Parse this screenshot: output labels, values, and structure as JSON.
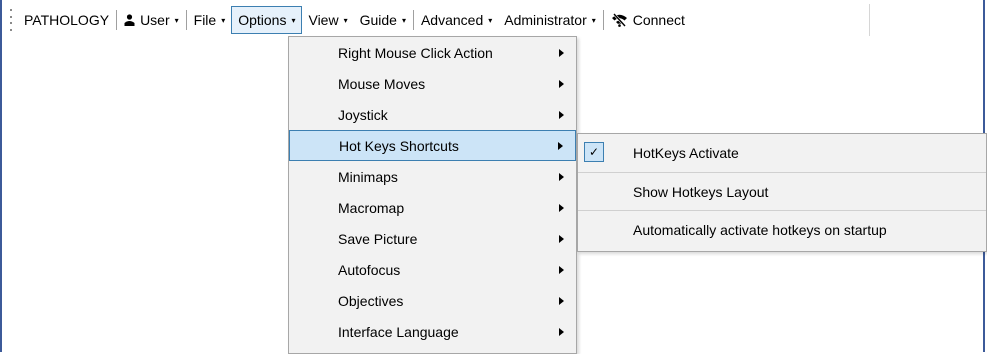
{
  "menubar": {
    "items": [
      {
        "label": "PATHOLOGY"
      },
      {
        "label": "User",
        "caret": "▾",
        "icon": "user-icon"
      },
      {
        "label": "File",
        "caret": "▾"
      },
      {
        "label": "Options",
        "caret": "▾"
      },
      {
        "label": "View",
        "caret": "▾"
      },
      {
        "label": "Guide",
        "caret": "▾"
      },
      {
        "label": "Advanced",
        "caret": "▾"
      },
      {
        "label": "Administrator",
        "caret": "▾"
      },
      {
        "label": "Connect",
        "icon": "wifi-off-icon"
      }
    ]
  },
  "options_menu": {
    "items": [
      {
        "label": "Right Mouse Click Action"
      },
      {
        "label": "Mouse Moves"
      },
      {
        "label": "Joystick"
      },
      {
        "label": "Hot Keys Shortcuts"
      },
      {
        "label": "Minimaps"
      },
      {
        "label": "Macromap"
      },
      {
        "label": "Save Picture"
      },
      {
        "label": "Autofocus"
      },
      {
        "label": "Objectives"
      },
      {
        "label": "Interface Language"
      }
    ]
  },
  "hotkeys_submenu": {
    "items": [
      {
        "label": "HotKeys Activate",
        "checked": true,
        "check_glyph": "✓"
      },
      {
        "label": "Show Hotkeys Layout"
      },
      {
        "label": "Automatically activate hotkeys on startup"
      }
    ]
  },
  "colors": {
    "frame": "#3c5a99",
    "menu_bg": "#f2f2f2",
    "highlight": "#cce4f7",
    "highlight_border": "#3c7fb1"
  }
}
